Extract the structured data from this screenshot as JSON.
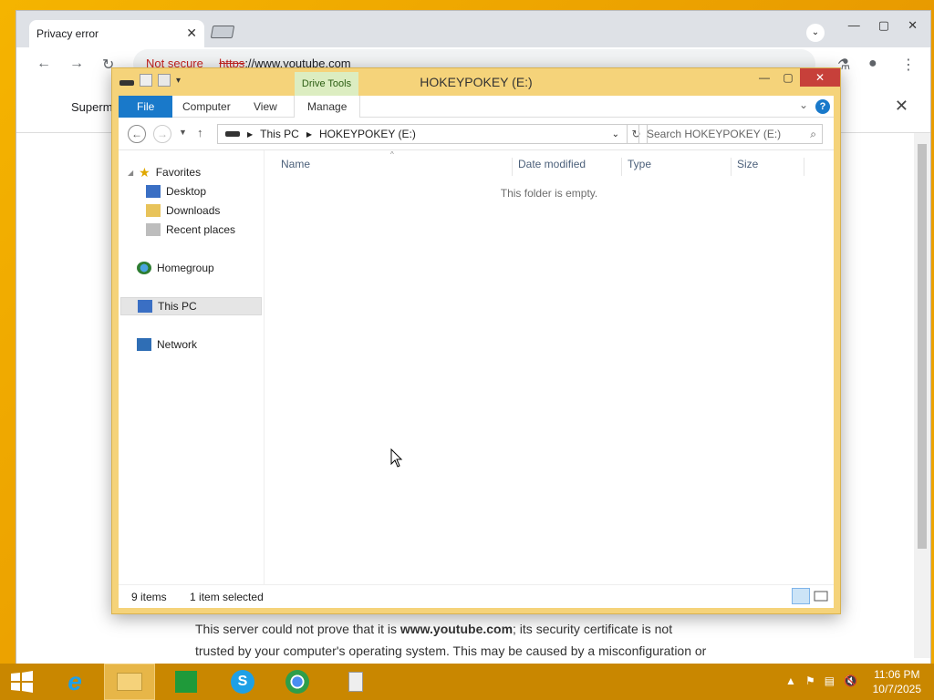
{
  "chrome": {
    "tab_title": "Privacy error",
    "omnibox": {
      "not_secure": "Not secure",
      "scheme": "https",
      "url": "://www.youtube.com"
    },
    "infobar_text": "Superm",
    "privacy_line1_prefix": "This server could not prove that it is ",
    "privacy_line1_domain": "www.youtube.com",
    "privacy_line1_suffix": "; its security certificate is not",
    "privacy_line2": "trusted by your computer's operating system. This may be caused by a misconfiguration or"
  },
  "explorer": {
    "title": "HOKEYPOKEY (E:)",
    "contextual_tab": "Drive Tools",
    "ribbon_tabs": [
      "File",
      "Computer",
      "View",
      "Manage"
    ],
    "address": {
      "root": "This PC",
      "current": "HOKEYPOKEY (E:)"
    },
    "search_placeholder": "Search HOKEYPOKEY (E:)",
    "nav": {
      "favorites": "Favorites",
      "desktop": "Desktop",
      "downloads": "Downloads",
      "recent": "Recent places",
      "homegroup": "Homegroup",
      "thispc": "This PC",
      "network": "Network"
    },
    "columns": [
      "Name",
      "Date modified",
      "Type",
      "Size"
    ],
    "empty_message": "This folder is empty.",
    "status": {
      "items": "9 items",
      "selected": "1 item selected"
    }
  },
  "taskbar": {
    "time": "11:06 PM",
    "date": "10/7/2025"
  },
  "colors": {
    "accent_file_tab": "#1979ca",
    "drive_tools": "#dcedc1",
    "close_btn": "#c7403a",
    "taskbar": "#c98700"
  }
}
